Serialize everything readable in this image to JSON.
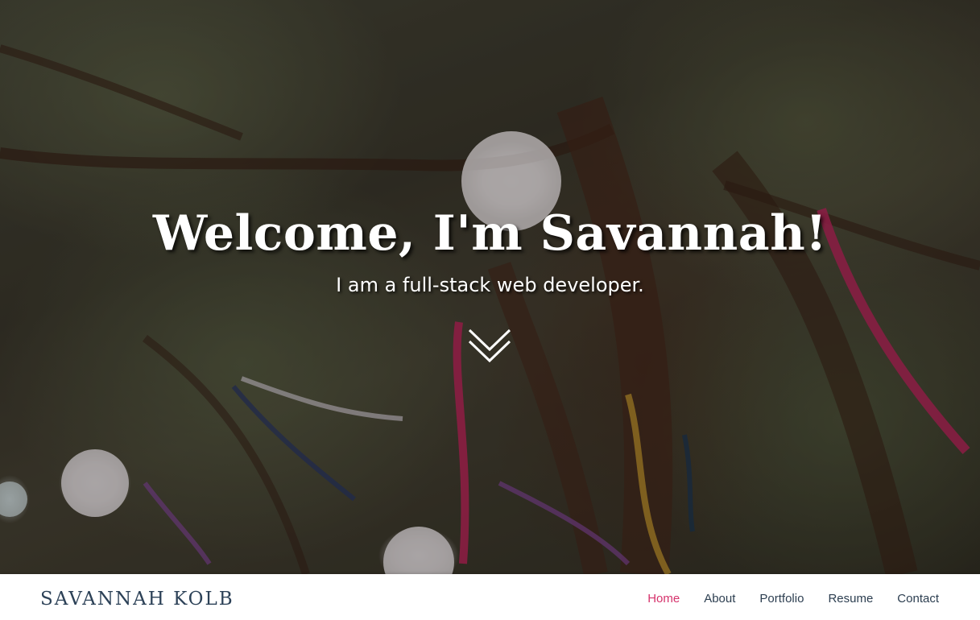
{
  "hero": {
    "title": "Welcome, I'm Savannah!",
    "subtitle": "I am a full-stack web developer.",
    "scroll_icon": "double-chevron-down-icon"
  },
  "navbar": {
    "brand": "SAVANNAH KOLB",
    "links": [
      {
        "label": "Home",
        "active": true
      },
      {
        "label": "About",
        "active": false
      },
      {
        "label": "Portfolio",
        "active": false
      },
      {
        "label": "Resume",
        "active": false
      },
      {
        "label": "Contact",
        "active": false
      }
    ]
  },
  "colors": {
    "brand": "#2c4157",
    "nav_text": "#2c3e50",
    "nav_active": "#d6336c",
    "hero_text": "#ffffff"
  }
}
